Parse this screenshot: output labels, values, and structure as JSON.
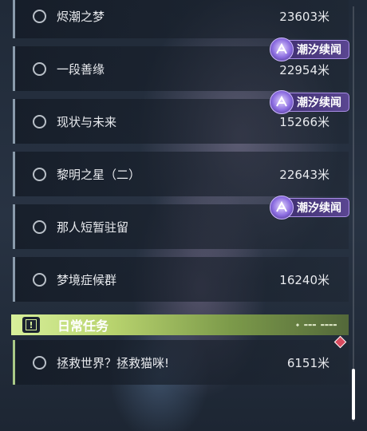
{
  "quests": [
    {
      "title": "烬潮之梦",
      "distance": "23603米"
    },
    {
      "title": "一段善缘",
      "distance": "22954米",
      "badge": "潮汐续闻"
    },
    {
      "title": "现状与未来",
      "distance": "15266米",
      "badge": "潮汐续闻"
    },
    {
      "title": "黎明之星（二）",
      "distance": "22643米"
    },
    {
      "title": "那人短暂驻留",
      "distance": "",
      "badge": "潮汐续闻"
    },
    {
      "title": "梦境症候群",
      "distance": "16240米"
    }
  ],
  "daily_section": {
    "title": "日常任务",
    "icon_glyph": "!"
  },
  "daily_quests": [
    {
      "title": "拯救世界？拯救猫咪!",
      "distance": "6151米"
    }
  ],
  "colors": {
    "section_accent": "#c9e483",
    "badge_bg": "#4a3a80",
    "marker": "#d84a5e"
  }
}
